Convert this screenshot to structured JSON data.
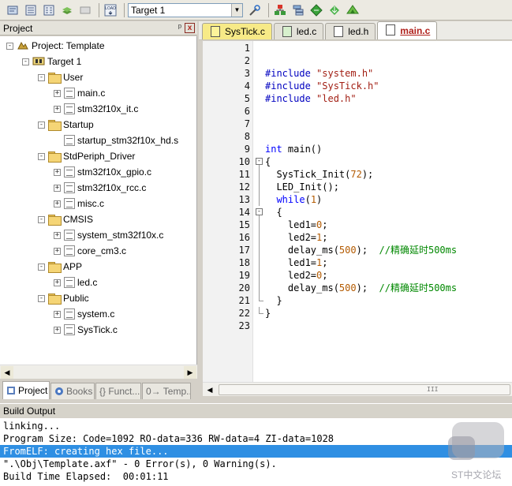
{
  "toolbar": {
    "target_value": "Target 1",
    "icons": [
      "translate-icon",
      "build-icon",
      "rebuild-icon",
      "batch-build-icon",
      "stop-build-icon",
      "load-icon",
      "target-options-icon",
      "manage-components-icon",
      "file-extensions-icon",
      "select-packs-icon",
      "pack-installer-icon",
      "manage-runtime-icon"
    ],
    "load_label": "LOAD"
  },
  "project_panel": {
    "title": "Project",
    "pin_glyph": "ᵖ",
    "close_glyph": "x",
    "tree": [
      {
        "label": "Project: Template",
        "level": 0,
        "kind": "project",
        "toggle": "-"
      },
      {
        "label": "Target 1",
        "level": 1,
        "kind": "target",
        "toggle": "-"
      },
      {
        "label": "User",
        "level": 2,
        "kind": "folder",
        "toggle": "-"
      },
      {
        "label": "main.c",
        "level": 3,
        "kind": "file",
        "toggle": "+"
      },
      {
        "label": "stm32f10x_it.c",
        "level": 3,
        "kind": "file",
        "toggle": "+"
      },
      {
        "label": "Startup",
        "level": 2,
        "kind": "folder",
        "toggle": "-"
      },
      {
        "label": "startup_stm32f10x_hd.s",
        "level": 3,
        "kind": "file",
        "toggle": ""
      },
      {
        "label": "StdPeriph_Driver",
        "level": 2,
        "kind": "folder",
        "toggle": "-"
      },
      {
        "label": "stm32f10x_gpio.c",
        "level": 3,
        "kind": "file",
        "toggle": "+"
      },
      {
        "label": "stm32f10x_rcc.c",
        "level": 3,
        "kind": "file",
        "toggle": "+"
      },
      {
        "label": "misc.c",
        "level": 3,
        "kind": "file",
        "toggle": "+"
      },
      {
        "label": "CMSIS",
        "level": 2,
        "kind": "folder",
        "toggle": "-"
      },
      {
        "label": "system_stm32f10x.c",
        "level": 3,
        "kind": "file",
        "toggle": "+"
      },
      {
        "label": "core_cm3.c",
        "level": 3,
        "kind": "file",
        "toggle": "+"
      },
      {
        "label": "APP",
        "level": 2,
        "kind": "folder",
        "toggle": "-"
      },
      {
        "label": "led.c",
        "level": 3,
        "kind": "file",
        "toggle": "+"
      },
      {
        "label": "Public",
        "level": 2,
        "kind": "folder",
        "toggle": "-"
      },
      {
        "label": "system.c",
        "level": 3,
        "kind": "file",
        "toggle": "+"
      },
      {
        "label": "SysTick.c",
        "level": 3,
        "kind": "file",
        "toggle": "+"
      }
    ],
    "tabs": [
      {
        "label": "Project",
        "active": true
      },
      {
        "label": "Books",
        "active": false
      },
      {
        "label": "{} Funct...",
        "active": false
      },
      {
        "label": "0→ Temp...",
        "active": false
      }
    ]
  },
  "editor": {
    "tabs": [
      {
        "label": "SysTick.c",
        "style": "yellow",
        "active": false
      },
      {
        "label": "led.c",
        "style": "green",
        "active": false
      },
      {
        "label": "led.h",
        "style": "plain",
        "active": false
      },
      {
        "label": "main.c",
        "style": "plain",
        "active": true
      }
    ],
    "lines": [
      {
        "n": "1",
        "fold": "",
        "seg": []
      },
      {
        "n": "2",
        "fold": "",
        "seg": []
      },
      {
        "n": "3",
        "fold": "",
        "seg": [
          [
            "pre",
            "#include "
          ],
          [
            "str",
            "\"system.h\""
          ]
        ]
      },
      {
        "n": "4",
        "fold": "",
        "seg": [
          [
            "pre",
            "#include "
          ],
          [
            "str",
            "\"SysTick.h\""
          ]
        ]
      },
      {
        "n": "5",
        "fold": "",
        "seg": [
          [
            "pre",
            "#include "
          ],
          [
            "str",
            "\"led.h\""
          ]
        ]
      },
      {
        "n": "6",
        "fold": "",
        "seg": []
      },
      {
        "n": "7",
        "fold": "",
        "seg": []
      },
      {
        "n": "8",
        "fold": "",
        "seg": []
      },
      {
        "n": "9",
        "fold": "",
        "seg": [
          [
            "kw",
            "int"
          ],
          [
            "plain",
            " main()"
          ]
        ]
      },
      {
        "n": "10",
        "fold": "box",
        "seg": [
          [
            "plain",
            "{"
          ]
        ]
      },
      {
        "n": "11",
        "fold": "line",
        "seg": [
          [
            "plain",
            "  SysTick_Init("
          ],
          [
            "num",
            "72"
          ],
          [
            "plain",
            ");"
          ]
        ]
      },
      {
        "n": "12",
        "fold": "line",
        "seg": [
          [
            "plain",
            "  LED_Init();"
          ]
        ]
      },
      {
        "n": "13",
        "fold": "line",
        "seg": [
          [
            "plain",
            "  "
          ],
          [
            "kw",
            "while"
          ],
          [
            "plain",
            "("
          ],
          [
            "num",
            "1"
          ],
          [
            "plain",
            ")"
          ]
        ]
      },
      {
        "n": "14",
        "fold": "box",
        "seg": [
          [
            "plain",
            "  {"
          ]
        ]
      },
      {
        "n": "15",
        "fold": "line",
        "seg": [
          [
            "plain",
            "    led1="
          ],
          [
            "num",
            "0"
          ],
          [
            "plain",
            ";"
          ]
        ]
      },
      {
        "n": "16",
        "fold": "line",
        "seg": [
          [
            "plain",
            "    led2="
          ],
          [
            "num",
            "1"
          ],
          [
            "plain",
            ";"
          ]
        ]
      },
      {
        "n": "17",
        "fold": "line",
        "seg": [
          [
            "plain",
            "    delay_ms("
          ],
          [
            "num",
            "500"
          ],
          [
            "plain",
            ");  "
          ],
          [
            "com",
            "//精确延时500ms"
          ]
        ]
      },
      {
        "n": "18",
        "fold": "line",
        "seg": [
          [
            "plain",
            "    led1="
          ],
          [
            "num",
            "1"
          ],
          [
            "plain",
            ";"
          ]
        ]
      },
      {
        "n": "19",
        "fold": "line",
        "seg": [
          [
            "plain",
            "    led2="
          ],
          [
            "num",
            "0"
          ],
          [
            "plain",
            ";"
          ]
        ]
      },
      {
        "n": "20",
        "fold": "line",
        "seg": [
          [
            "plain",
            "    delay_ms("
          ],
          [
            "num",
            "500"
          ],
          [
            "plain",
            ");  "
          ],
          [
            "com",
            "//精确延时500ms"
          ]
        ]
      },
      {
        "n": "21",
        "fold": "end",
        "seg": [
          [
            "plain",
            "  }"
          ]
        ]
      },
      {
        "n": "22",
        "fold": "end",
        "seg": [
          [
            "plain",
            "}"
          ]
        ]
      },
      {
        "n": "23",
        "fold": "",
        "seg": []
      }
    ],
    "scroll_grip": "III"
  },
  "build_output": {
    "title": "Build Output",
    "lines": [
      {
        "text": "linking...",
        "highlight": false
      },
      {
        "text": "Program Size: Code=1092 RO-data=336 RW-data=4 ZI-data=1028",
        "highlight": false
      },
      {
        "text": "FromELF: creating hex file...",
        "highlight": true
      },
      {
        "text": "\".\\Obj\\Template.axf\" - 0 Error(s), 0 Warning(s).",
        "highlight": false
      },
      {
        "text": "Build Time Elapsed:  00:01:11",
        "highlight": false
      }
    ],
    "watermark": "ST中文论坛"
  },
  "colors": {
    "highlight": "#2f8fe3",
    "active_tab_text": "#b0201b",
    "keyword": "#0000ff",
    "string": "#a21f14",
    "comment": "#008800",
    "number": "#b35a00"
  }
}
